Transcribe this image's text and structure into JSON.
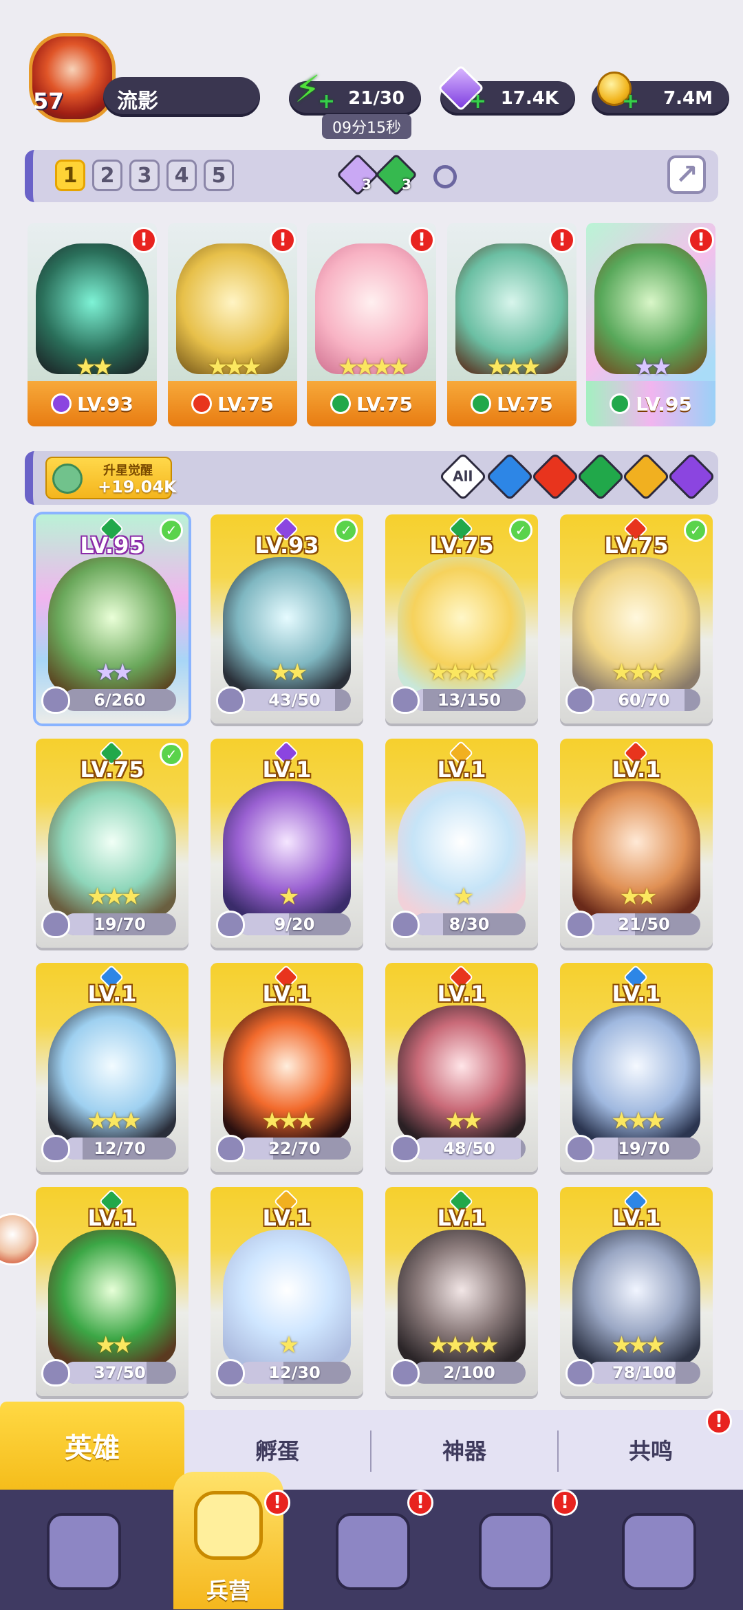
{
  "player": {
    "level": "57",
    "name": "流影"
  },
  "resources": {
    "energy": "21/30",
    "energy_timer": "09分15秒",
    "gems": "17.4K",
    "coins": "7.4M"
  },
  "team_slots": [
    "1",
    "2",
    "3",
    "4",
    "5"
  ],
  "team_badges": {
    "purple": "3",
    "green": "3"
  },
  "team": [
    {
      "level": "LV.93",
      "element": "purple",
      "stars": "★★"
    },
    {
      "level": "LV.75",
      "element": "red",
      "stars": "★★★"
    },
    {
      "level": "LV.75",
      "element": "green",
      "stars": "★★★★"
    },
    {
      "level": "LV.75",
      "element": "green",
      "stars": "★★★"
    },
    {
      "level": "LV.95",
      "element": "green",
      "stars": "★★"
    }
  ],
  "upgrade": {
    "label": "升星觉醒",
    "value": "+19.04K"
  },
  "filters": {
    "all_label": "All"
  },
  "heroes": [
    {
      "level": "LV.95",
      "progress": "6/260",
      "fraction": 0.02,
      "element": "green",
      "stars": "★★",
      "checked": true
    },
    {
      "level": "LV.93",
      "progress": "43/50",
      "fraction": 0.86,
      "element": "purple",
      "stars": "★★",
      "checked": true
    },
    {
      "level": "LV.75",
      "progress": "13/150",
      "fraction": 0.09,
      "element": "green",
      "stars": "★★★★",
      "checked": true
    },
    {
      "level": "LV.75",
      "progress": "60/70",
      "fraction": 0.86,
      "element": "red",
      "stars": "★★★",
      "checked": true
    },
    {
      "level": "LV.75",
      "progress": "19/70",
      "fraction": 0.27,
      "element": "green",
      "stars": "★★★",
      "checked": true
    },
    {
      "level": "LV.1",
      "progress": "9/20",
      "fraction": 0.45,
      "element": "purple",
      "stars": "★",
      "checked": false
    },
    {
      "level": "LV.1",
      "progress": "8/30",
      "fraction": 0.27,
      "element": "yellow",
      "stars": "★",
      "checked": false
    },
    {
      "level": "LV.1",
      "progress": "21/50",
      "fraction": 0.42,
      "element": "red",
      "stars": "★★",
      "checked": false
    },
    {
      "level": "LV.1",
      "progress": "12/70",
      "fraction": 0.17,
      "element": "blue",
      "stars": "★★★",
      "checked": false
    },
    {
      "level": "LV.1",
      "progress": "22/70",
      "fraction": 0.31,
      "element": "red",
      "stars": "★★★",
      "checked": false
    },
    {
      "level": "LV.1",
      "progress": "48/50",
      "fraction": 0.96,
      "element": "red",
      "stars": "★★",
      "checked": false
    },
    {
      "level": "LV.1",
      "progress": "19/70",
      "fraction": 0.27,
      "element": "blue",
      "stars": "★★★",
      "checked": false
    },
    {
      "level": "LV.1",
      "progress": "37/50",
      "fraction": 0.74,
      "element": "green",
      "stars": "★★",
      "checked": false
    },
    {
      "level": "LV.1",
      "progress": "12/30",
      "fraction": 0.4,
      "element": "yellow",
      "stars": "★",
      "checked": false
    },
    {
      "level": "LV.1",
      "progress": "2/100",
      "fraction": 0.02,
      "element": "green",
      "stars": "★★★★",
      "checked": false
    },
    {
      "level": "LV.1",
      "progress": "78/100",
      "fraction": 0.78,
      "element": "blue",
      "stars": "★★★",
      "checked": false
    }
  ],
  "tabs": [
    "英雄",
    "孵蛋",
    "神器",
    "共鸣"
  ],
  "nav": {
    "barracks_label": "兵营"
  },
  "alert_mark": "!",
  "colors": {
    "purple": "#8b45e0",
    "red": "#e8341d",
    "green": "#21a84a",
    "blue": "#2d86e6",
    "yellow": "#f1b020",
    "accent": "#ffd336"
  }
}
